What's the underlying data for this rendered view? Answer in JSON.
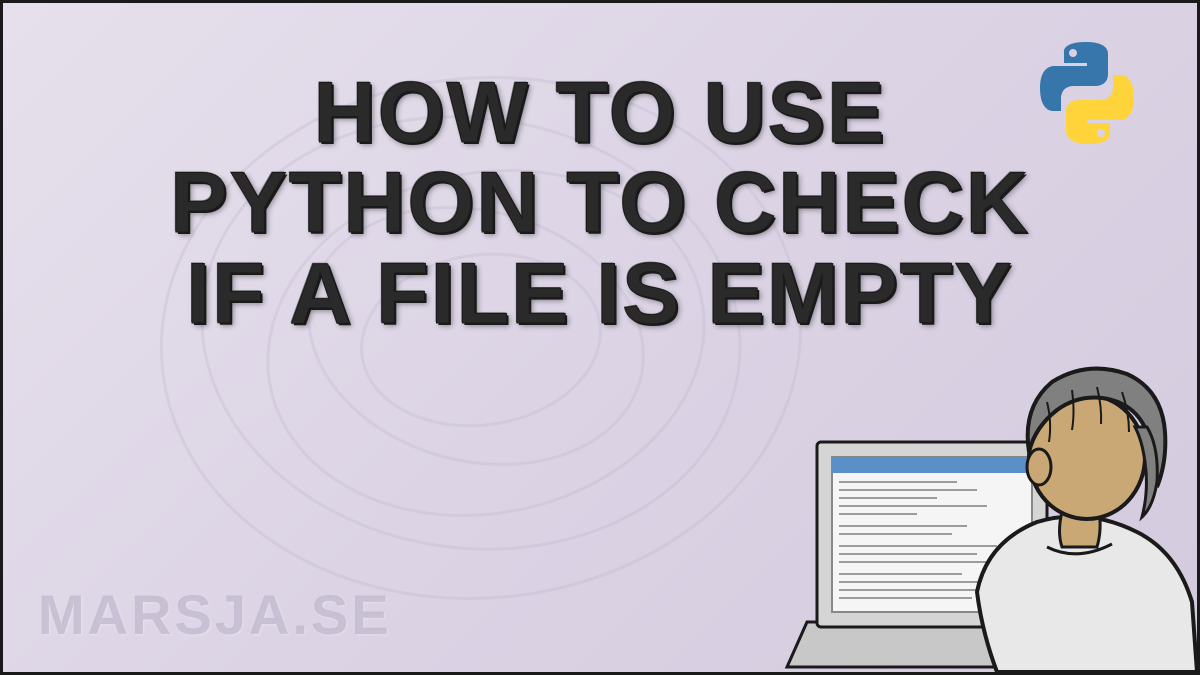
{
  "title": "HOW TO USE PYTHON TO CHECK IF A FILE IS EMPTY",
  "watermark": "MARSJA.SE",
  "logo": {
    "name": "python-logo",
    "colors": {
      "blue": "#3776ab",
      "yellow": "#ffd43b"
    }
  },
  "illustration": {
    "name": "person-at-laptop"
  }
}
